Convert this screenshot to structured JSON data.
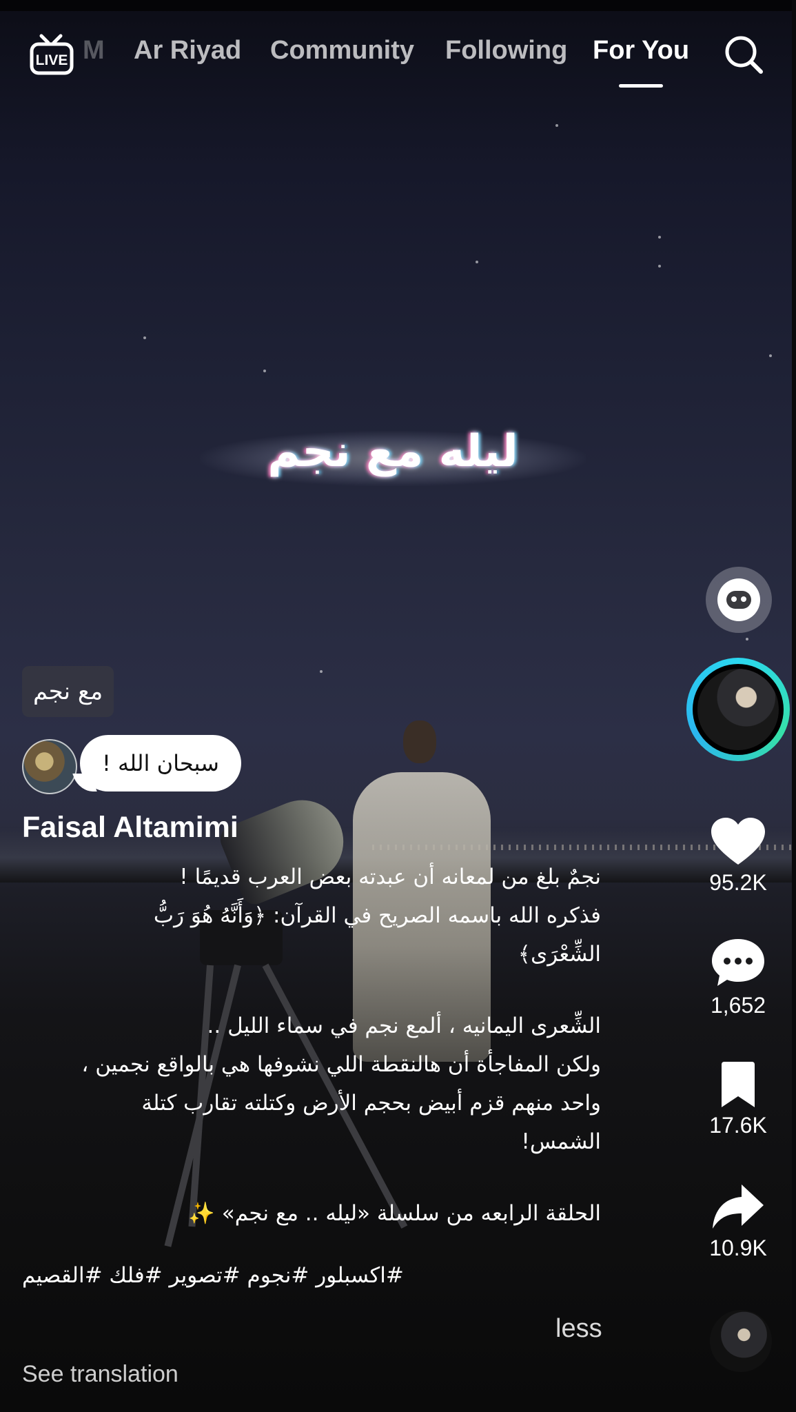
{
  "nav": {
    "live_label": "LIVE",
    "faded_tab": "M",
    "tabs": [
      "Ar Riyad",
      "Community",
      "Following",
      "For You"
    ],
    "active_tab": "For You"
  },
  "video": {
    "overlay_title": "ليله مع نجم"
  },
  "actions": {
    "likes": "95.2K",
    "comments": "1,652",
    "saves": "17.6K",
    "shares": "10.9K"
  },
  "post": {
    "chip_label": "مع نجم",
    "comment_bubble": "سبحان الله !",
    "username": "Faisal Altamimi",
    "caption_lines": [
      "نجمٌ بلغ من لمعانه أن عبدته بعض العرب قديمًا !",
      "فذكره الله باسمه الصريح في القرآن: ﴿وَأَنَّهُ هُوَ رَبُّ",
      "الشِّعْرَى﴾",
      "الشِّعرى اليمانيه ، ألمع نجم في سماء الليل ..",
      "ولكن المفاجأة أن هالنقطة اللي نشوفها هي بالواقع نجمين ،",
      "واحد منهم قزم أبيض بحجم الأرض وكتلته تقارب كتلة",
      "الشمس!",
      "الحلقة الرابعه من سلسلة «ليله .. مع نجم» ✨"
    ],
    "hashtags": "#اكسبلور #نجوم #تصوير #فلك #القصيم",
    "less_label": "less",
    "see_translation": "See translation"
  },
  "colors": {
    "accent_ring": "#2bd7f0",
    "text": "#ffffff"
  },
  "icons": [
    "live-icon",
    "search-icon",
    "ai-bot-icon",
    "heart-icon",
    "comment-icon",
    "bookmark-icon",
    "share-icon"
  ]
}
